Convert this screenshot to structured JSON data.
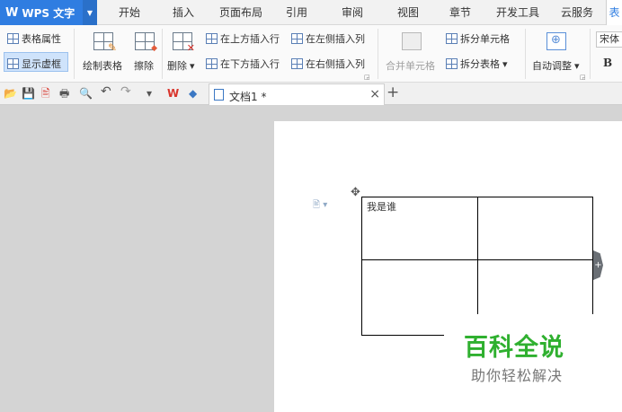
{
  "app": {
    "logo": "W",
    "name": "WPS 文字",
    "dropdown": "▼"
  },
  "menu_tabs": [
    "开始",
    "插入",
    "页面布局",
    "引用",
    "审阅",
    "视图",
    "章节",
    "开发工具",
    "云服务",
    "表"
  ],
  "ribbon": {
    "table_props": "表格属性",
    "show_gridlines": "显示虚框",
    "draw_table": "绘制表格",
    "eraser": "擦除",
    "delete": "删除",
    "insert_above": "在上方插入行",
    "insert_below": "在下方插入行",
    "insert_left": "在左侧插入列",
    "insert_right": "在右侧插入列",
    "merge_cells": "合并单元格",
    "split_cells": "拆分单元格",
    "split_table": "拆分表格",
    "autofit": "自动调整",
    "font_name": "宋体",
    "bold": "B",
    "dropdown_arrow": "▾"
  },
  "quickbar": {
    "open": "📂",
    "save": "💾",
    "export": "🖹",
    "print": "🖶",
    "preview": "🔍",
    "undo": "↶",
    "redo": "↷",
    "more": "▾",
    "wps_logo": "W",
    "cube": "◆"
  },
  "doc_tab": {
    "title": "文档1 *",
    "close": "×",
    "new": "+"
  },
  "document": {
    "table": [
      [
        "我是谁",
        ""
      ],
      [
        "",
        ""
      ]
    ],
    "para_mark": "🖹 ▾",
    "move_handle": "✥",
    "add_col": "+"
  },
  "watermark": {
    "title": "百科全说",
    "subtitle": "助你轻松解决"
  },
  "colors": {
    "accent": "#2f7de1",
    "watermark_green": "#2fb02f"
  }
}
